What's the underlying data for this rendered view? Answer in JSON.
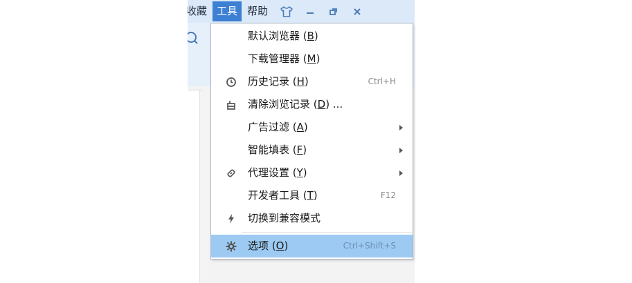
{
  "menubar": {
    "partial_item": "收藏",
    "tools_label": "工具",
    "help_label": "帮助",
    "skin_icon": "tshirt-icon",
    "minimize_icon": "minimize-icon",
    "restore_icon": "restore-icon",
    "close_icon": "close-icon"
  },
  "toolbar": {
    "search_icon": "search-icon"
  },
  "dropdown": {
    "items": [
      {
        "label_pre": "默认浏览器 (",
        "accel": "B",
        "label_post": ")",
        "shortcut": "",
        "icon": "",
        "submenu": false
      },
      {
        "label_pre": "下载管理器 (",
        "accel": "M",
        "label_post": ")",
        "shortcut": "",
        "icon": "",
        "submenu": false
      },
      {
        "label_pre": "历史记录 (",
        "accel": "H",
        "label_post": ")",
        "shortcut": "Ctrl+H",
        "icon": "clock-icon",
        "submenu": false
      },
      {
        "label_pre": "清除浏览记录 (",
        "accel": "D",
        "label_post": ") ...",
        "shortcut": "",
        "icon": "eraser-icon",
        "submenu": false
      },
      {
        "label_pre": "广告过滤 (",
        "accel": "A",
        "label_post": ")",
        "shortcut": "",
        "icon": "",
        "submenu": true
      },
      {
        "label_pre": "智能填表 (",
        "accel": "F",
        "label_post": ")",
        "shortcut": "",
        "icon": "",
        "submenu": true
      },
      {
        "label_pre": "代理设置 (",
        "accel": "Y",
        "label_post": ")",
        "shortcut": "",
        "icon": "link-icon",
        "submenu": true
      },
      {
        "label_pre": "开发者工具 (",
        "accel": "T",
        "label_post": ")",
        "shortcut": "F12",
        "icon": "",
        "submenu": false
      },
      {
        "label_pre": "切换到兼容模式",
        "accel": "",
        "label_post": "",
        "shortcut": "",
        "icon": "lightning-icon",
        "submenu": false
      },
      {
        "label_pre": "选项 (",
        "accel": "O",
        "label_post": ")",
        "shortcut": "Ctrl+Shift+S",
        "icon": "gear-icon",
        "submenu": false
      }
    ]
  },
  "colors": {
    "menubar_bg": "#dbe9f8",
    "active_menu_bg": "#3c7fd3",
    "selected_item_bg": "#9ccaf3",
    "icon_color": "#555555"
  }
}
